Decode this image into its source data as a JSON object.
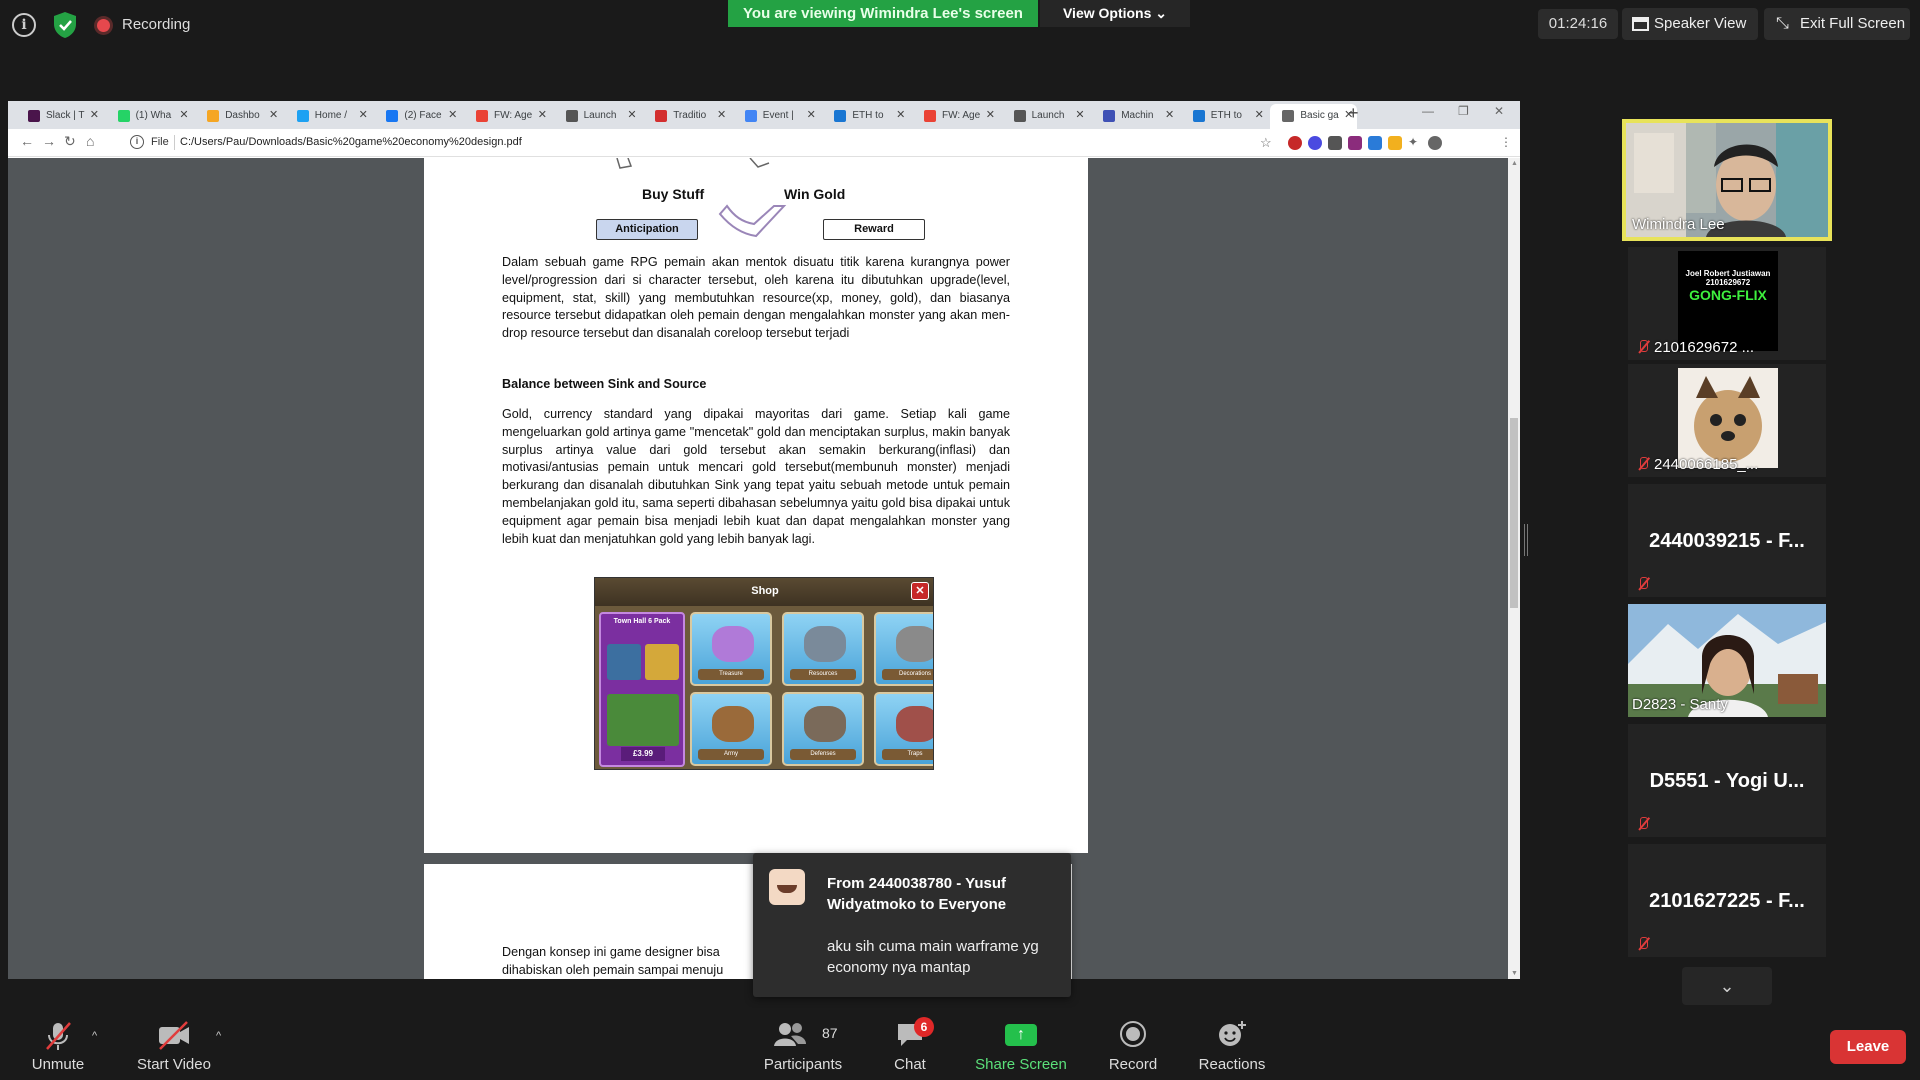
{
  "topbar": {
    "recording_label": "Recording",
    "viewing_banner": "You are viewing Wimindra Lee's screen",
    "view_options": "View Options",
    "timer": "01:24:16",
    "speaker_view": "Speaker View",
    "exit_fullscreen": "Exit Full Screen"
  },
  "browser": {
    "tabs": [
      {
        "label": "Slack | T",
        "color": "#4a154b"
      },
      {
        "label": "(1) Wha",
        "color": "#25d366"
      },
      {
        "label": "Dashbo",
        "color": "#f5a623"
      },
      {
        "label": "Home /",
        "color": "#1da1f2"
      },
      {
        "label": "(2) Face",
        "color": "#1877f2"
      },
      {
        "label": "FW: Age",
        "color": "#ea4335"
      },
      {
        "label": "Launch",
        "color": "#555555"
      },
      {
        "label": "Traditio",
        "color": "#d32f2f"
      },
      {
        "label": "Event |",
        "color": "#4285f4"
      },
      {
        "label": "ETH to",
        "color": "#1976d2"
      },
      {
        "label": "FW: Age",
        "color": "#ea4335"
      },
      {
        "label": "Launch",
        "color": "#555555"
      },
      {
        "label": "Machin",
        "color": "#3f51b5"
      },
      {
        "label": "ETH to",
        "color": "#1976d2"
      },
      {
        "label": "Basic ga",
        "color": "#666666"
      }
    ],
    "address_scheme": "File",
    "address_url": "C:/Users/Pau/Downloads/Basic%20game%20economy%20design.pdf"
  },
  "pdf": {
    "diagram_left": "Buy Stuff",
    "diagram_right": "Win Gold",
    "box_left": "Anticipation",
    "box_right": "Reward",
    "para1": "Dalam sebuah game RPG pemain akan mentok disuatu titik karena kurangnya power level/progression dari si character tersebut, oleh karena itu dibutuhkan upgrade(level, equipment, stat, skill) yang membutuhkan resource(xp, money, gold), dan biasanya resource tersebut didapatkan oleh pemain dengan mengalahkan monster yang akan men-drop resource tersebut dan disanalah coreloop tersebut terjadi",
    "heading": "Balance between Sink and Source",
    "para2": "Gold, currency standard yang dipakai mayoritas dari game. Setiap kali game mengeluarkan gold artinya game \"mencetak\" gold dan menciptakan surplus, makin banyak surplus artinya value dari gold tersebut akan semakin berkurang(inflasi) dan motivasi/antusias pemain untuk mencari gold tersebut(membunuh monster) menjadi berkurang dan disanalah dibutuhkan Sink yang tepat yaitu sebuah metode untuk pemain membelanjakan gold itu, sama seperti dibahasan sebelumnya yaitu gold bisa dipakai untuk equipment agar pemain bisa menjadi lebih kuat dan dapat mengalahkan monster yang lebih kuat dan menjatuhkan gold yang lebih banyak lagi.",
    "shop_title": "Shop",
    "shop_pack_title": "Town Hall 6 Pack",
    "shop_pack_price": "£3.99",
    "shop_tiles": [
      "Treasure",
      "Resources",
      "Decorations",
      "Army",
      "Defenses",
      "Traps"
    ],
    "page2_line1": "Dengan konsep ini game designer bisa",
    "page2_line2": "dihabiskan oleh pemain sampai menuju"
  },
  "notification": {
    "from": "From 2440038780 - Yusuf Widyatmoko to Everyone",
    "message": "aku sih cuma main warframe yg economy nya mantap"
  },
  "participants": {
    "tiles": [
      {
        "name": "Wimindra Lee"
      },
      {
        "name": "2101629672 ..."
      },
      {
        "name": "2440066185_..."
      },
      {
        "name": "2440039215 - F..."
      },
      {
        "name": "D2823 - Santy"
      },
      {
        "name": "D5551 - Yogi U..."
      },
      {
        "name": "2101627225 - F..."
      }
    ],
    "gongflix_lines": [
      "Joel Robert Justiawan",
      "2101629672",
      "GONG-FLIX"
    ]
  },
  "toolbar": {
    "unmute": "Unmute",
    "start_video": "Start Video",
    "participants": "Participants",
    "participants_count": "87",
    "chat": "Chat",
    "chat_badge": "6",
    "share_screen": "Share Screen",
    "record": "Record",
    "reactions": "Reactions",
    "leave": "Leave"
  }
}
